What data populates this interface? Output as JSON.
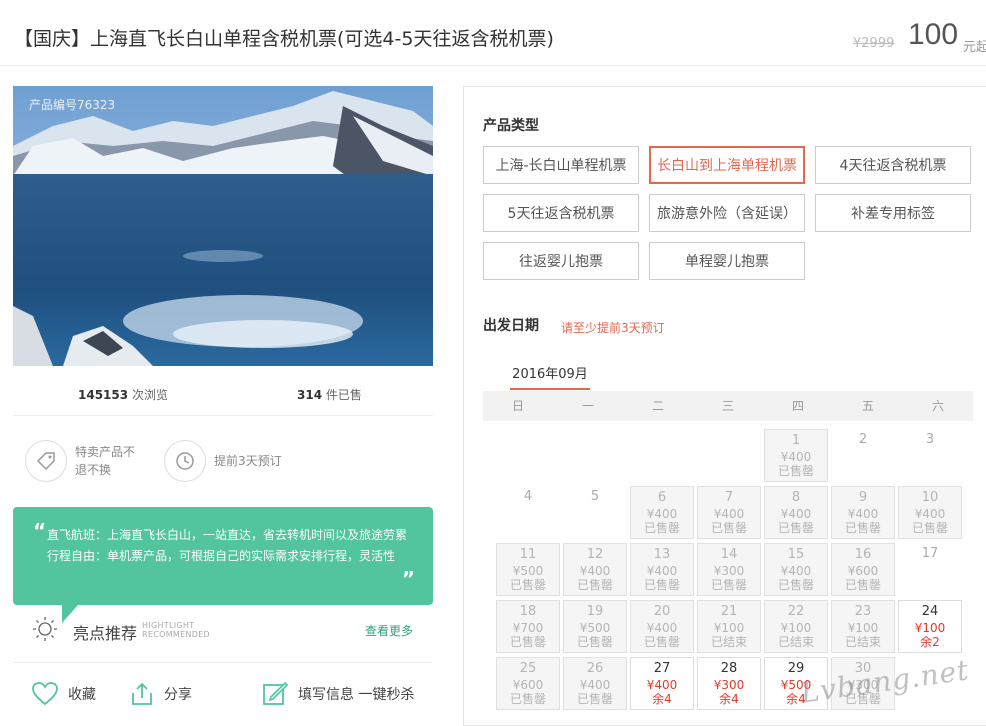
{
  "header": {
    "title": "【国庆】上海直飞长白山单程含税机票(可选4-5天往返含税机票)",
    "old_price": "¥2999",
    "price": "100",
    "price_unit": "元起"
  },
  "product": {
    "code": "产品编号76323",
    "views_count": "145153",
    "views_label": "次浏览",
    "sold_count": "314",
    "sold_label": "件已售",
    "features": [
      {
        "icon": "tag-icon",
        "text": "特卖产品不退不换"
      },
      {
        "icon": "clock-icon",
        "text": "提前3天预订"
      }
    ],
    "highlight_lines": [
      "直飞航班：上海直飞长白山，一站直达，省去转机时间以及旅途劳累",
      "行程自由：单机票产品，可根据自己的实际需求安排行程，灵活性"
    ],
    "recommend_label": "亮点推荐",
    "recommend_en1": "HIGHTLIGHT",
    "recommend_en2": "RECOMMENDED",
    "see_more": "查看更多",
    "actions": {
      "favorite": "收藏",
      "share": "分享",
      "fill_info": "填写信息 一键秒杀"
    }
  },
  "booking": {
    "type_title": "产品类型",
    "types": [
      "上海-长白山单程机票",
      "长白山到上海单程机票",
      "4天往返含税机票",
      "5天往返含税机票",
      "旅游意外险（含延误）",
      "补差专用标签",
      "往返婴儿抱票",
      "单程婴儿抱票"
    ],
    "date_title": "出发日期",
    "date_note": "请至少提前3天预订",
    "month": "2016年09月",
    "weekdays": [
      "日",
      "一",
      "二",
      "三",
      "四",
      "五",
      "六"
    ],
    "days": [
      {
        "d": "1",
        "price": "¥400",
        "status": "已售罄"
      },
      {
        "d": "2"
      },
      {
        "d": "3"
      },
      {
        "d": "4"
      },
      {
        "d": "5"
      },
      {
        "d": "6",
        "price": "¥400",
        "status": "已售罄"
      },
      {
        "d": "7",
        "price": "¥400",
        "status": "已售罄"
      },
      {
        "d": "8",
        "price": "¥400",
        "status": "已售罄"
      },
      {
        "d": "9",
        "price": "¥400",
        "status": "已售罄"
      },
      {
        "d": "10",
        "price": "¥400",
        "status": "已售罄"
      },
      {
        "d": "11",
        "price": "¥500",
        "status": "已售罄"
      },
      {
        "d": "12",
        "price": "¥400",
        "status": "已售罄"
      },
      {
        "d": "13",
        "price": "¥400",
        "status": "已售罄"
      },
      {
        "d": "14",
        "price": "¥300",
        "status": "已售罄"
      },
      {
        "d": "15",
        "price": "¥400",
        "status": "已售罄"
      },
      {
        "d": "16",
        "price": "¥600",
        "status": "已售罄"
      },
      {
        "d": "17"
      },
      {
        "d": "18",
        "price": "¥700",
        "status": "已售罄"
      },
      {
        "d": "19",
        "price": "¥500",
        "status": "已售罄"
      },
      {
        "d": "20",
        "price": "¥400",
        "status": "已售罄"
      },
      {
        "d": "21",
        "price": "¥100",
        "status": "已结束"
      },
      {
        "d": "22",
        "price": "¥100",
        "status": "已结束"
      },
      {
        "d": "23",
        "price": "¥100",
        "status": "已结束"
      },
      {
        "d": "24",
        "price": "¥100",
        "status": "余2"
      },
      {
        "d": "25",
        "price": "¥600",
        "status": "已售罄"
      },
      {
        "d": "26",
        "price": "¥400",
        "status": "已售罄"
      },
      {
        "d": "27",
        "price": "¥400",
        "status": "余4"
      },
      {
        "d": "28",
        "price": "¥300",
        "status": "余4"
      },
      {
        "d": "29",
        "price": "¥500",
        "status": "余4"
      },
      {
        "d": "30",
        "price": "¥300",
        "status": "已售罄"
      }
    ]
  },
  "watermark": "Lvbang.net",
  "colors": {
    "accent": "#e2694f",
    "green": "#52c59e",
    "price_red": "#e23b2b"
  }
}
